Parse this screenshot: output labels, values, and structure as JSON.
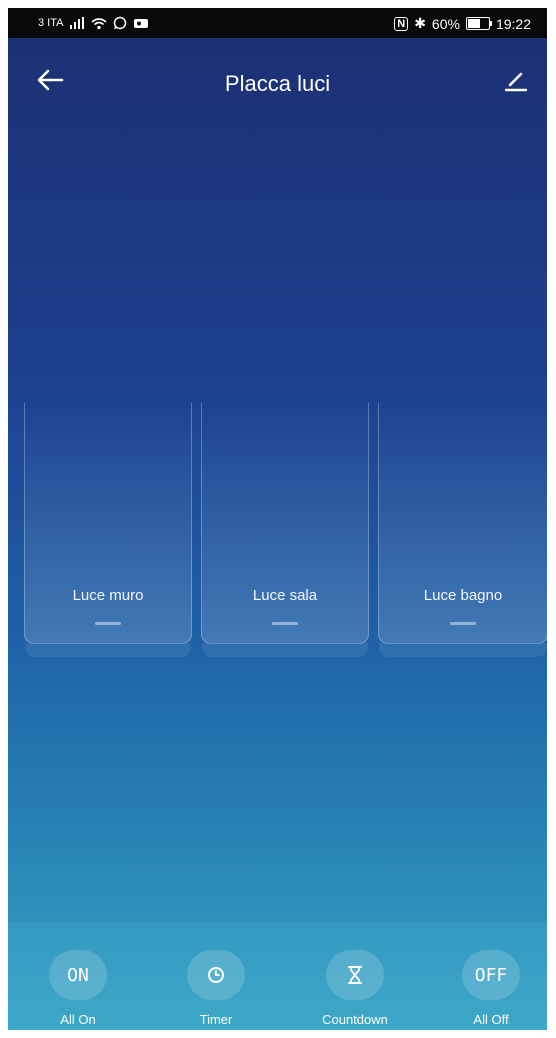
{
  "status_bar": {
    "carrier": "3 ITA",
    "nfc_label": "N",
    "bluetooth": "✱",
    "battery_percent_text": "60%",
    "battery_level": 0.6,
    "time": "19:22"
  },
  "header": {
    "title": "Placca luci",
    "back_icon": "back-arrow-icon",
    "edit_icon": "pencil-icon"
  },
  "switches": [
    {
      "label": "Luce muro"
    },
    {
      "label": "Luce sala"
    },
    {
      "label": "Luce bagno"
    }
  ],
  "actions": [
    {
      "label": "All On",
      "icon_text": "ON",
      "icon": "on-icon"
    },
    {
      "label": "Timer",
      "icon_text": "",
      "icon": "clock-icon"
    },
    {
      "label": "Countdown",
      "icon_text": "",
      "icon": "hourglass-icon"
    },
    {
      "label": "All Off",
      "icon_text": "OFF",
      "icon": "off-icon"
    }
  ],
  "colors": {
    "background_top": "#1c2f72",
    "background_bottom": "#3aa4c4",
    "status_bar": "#0a0a0a",
    "text": "#ffffff"
  }
}
